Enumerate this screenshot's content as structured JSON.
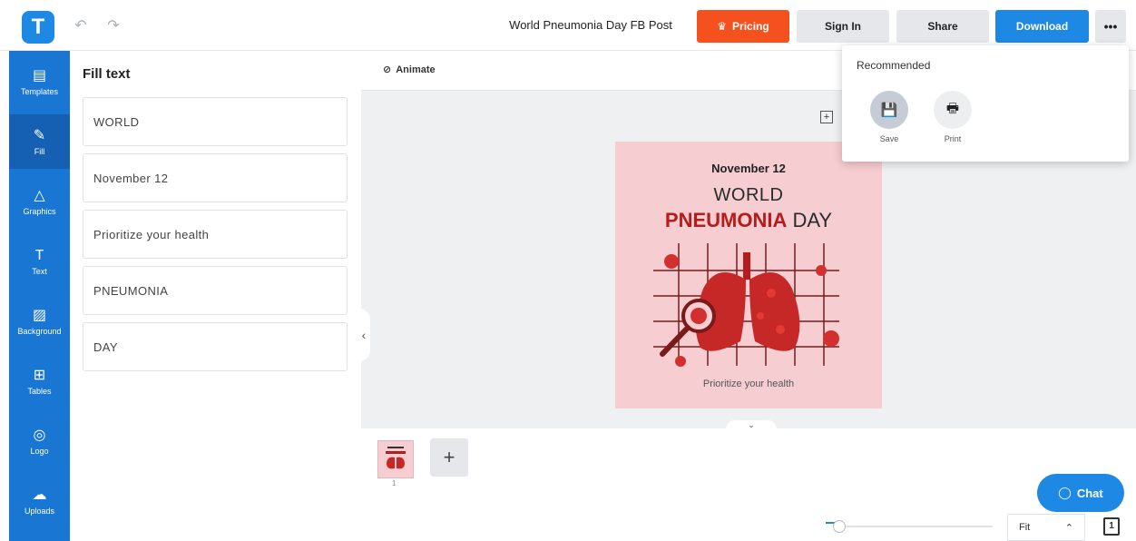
{
  "app": {
    "logo_letter": "T"
  },
  "header": {
    "undo_icon": "↶",
    "redo_icon": "↷",
    "doc_title": "World Pneumonia Day FB Post",
    "pricing_label": "Pricing",
    "signin_label": "Sign In",
    "share_label": "Share",
    "download_label": "Download",
    "more_label": "•••"
  },
  "sidebar": {
    "items": [
      {
        "label": "Templates",
        "icon": "▤"
      },
      {
        "label": "Fill",
        "icon": "✎"
      },
      {
        "label": "Graphics",
        "icon": "△"
      },
      {
        "label": "Text",
        "icon": "T"
      },
      {
        "label": "Background",
        "icon": "▨"
      },
      {
        "label": "Tables",
        "icon": "⊞"
      },
      {
        "label": "Logo",
        "icon": "◎"
      },
      {
        "label": "Uploads",
        "icon": "☁"
      }
    ]
  },
  "fill_panel": {
    "title": "Fill text",
    "fields": [
      "WORLD",
      "November 12",
      "Prioritize your health",
      "PNEUMONIA",
      "DAY"
    ]
  },
  "canvas": {
    "animate_label": "Animate",
    "add_icon": "+",
    "poster": {
      "date": "November 12",
      "line1": "WORLD",
      "line2a": "PNEUMONIA",
      "line2b": " DAY",
      "tagline": "Prioritize your health"
    },
    "collapse_icon": "‹",
    "expand_icon": "⌄"
  },
  "pages": {
    "thumb_number": "1",
    "add_label": "+"
  },
  "download_menu": {
    "title": "Recommended",
    "items": [
      {
        "label": "Save",
        "icon": "💾"
      },
      {
        "label": "Print",
        "icon": "🖶"
      }
    ]
  },
  "chat": {
    "label": "Chat"
  },
  "zoom": {
    "value": "Fit",
    "chevron": "⌃",
    "pages_icon": "1"
  },
  "colors": {
    "brand": "#1e88e5",
    "pricing": "#f4511e",
    "poster_bg": "#f6cdd0",
    "accent_red": "#b71c1c"
  }
}
